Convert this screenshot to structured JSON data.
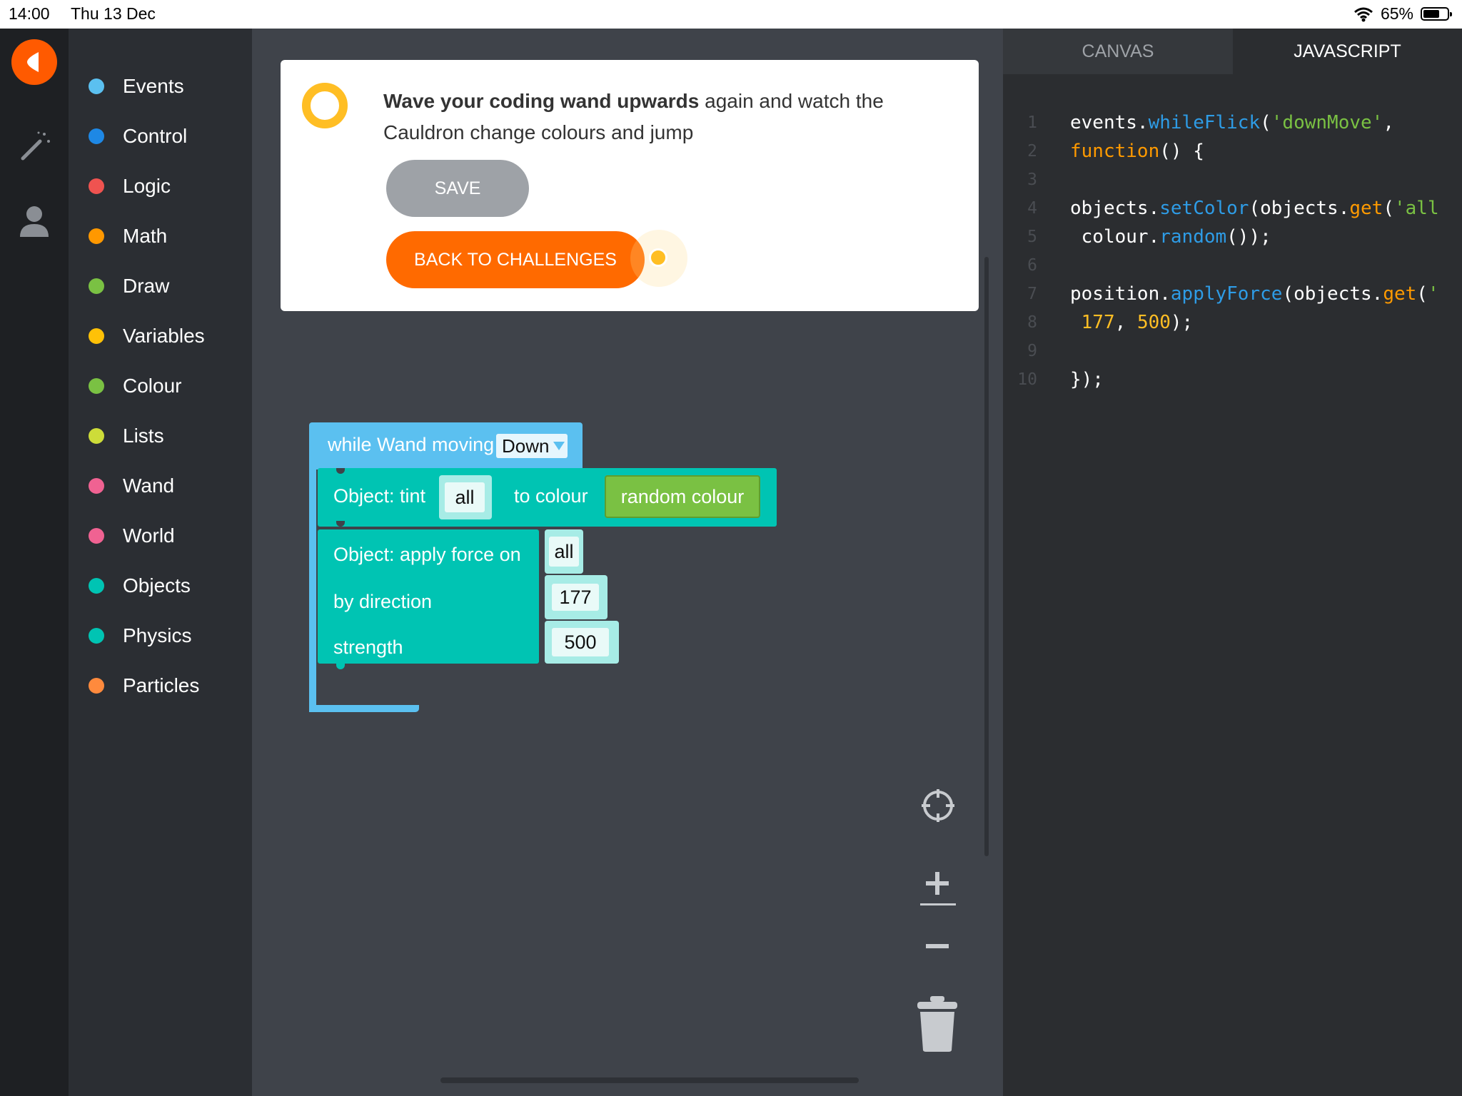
{
  "status_bar": {
    "time": "14:00",
    "date": "Thu 13 Dec",
    "battery": "65%"
  },
  "categories": [
    {
      "label": "Events",
      "color": "#5bc0f0"
    },
    {
      "label": "Control",
      "color": "#1e88e5"
    },
    {
      "label": "Logic",
      "color": "#ef5350"
    },
    {
      "label": "Math",
      "color": "#ff9800"
    },
    {
      "label": "Draw",
      "color": "#7ac143"
    },
    {
      "label": "Variables",
      "color": "#ffc107"
    },
    {
      "label": "Colour",
      "color": "#7ac143"
    },
    {
      "label": "Lists",
      "color": "#cddc39"
    },
    {
      "label": "Wand",
      "color": "#f06292"
    },
    {
      "label": "World",
      "color": "#f06292"
    },
    {
      "label": "Objects",
      "color": "#00c4b3"
    },
    {
      "label": "Physics",
      "color": "#00c4b3"
    },
    {
      "label": "Particles",
      "color": "#ff8a3d"
    }
  ],
  "challenge": {
    "bold": "Wave your coding wand upwards",
    "rest": " again and watch the Cauldron change colours and jump",
    "save_label": "SAVE",
    "back_label": "BACK TO CHALLENGES"
  },
  "blocks": {
    "hat_label": "while Wand moving",
    "hat_dropdown": "Down",
    "tint_label": "Object: tint",
    "tint_target": "all",
    "tint_to": "to colour",
    "tint_colour": "random colour",
    "force_label": "Object: apply force on",
    "force_target": "all",
    "direction_label": "by direction",
    "direction_value": "177",
    "strength_label": "strength",
    "strength_value": "500"
  },
  "panel": {
    "tab_canvas": "CANVAS",
    "tab_js": "JAVASCRIPT",
    "line_numbers": [
      "1",
      "2",
      "3",
      "4",
      "5",
      "6",
      "7",
      "8",
      "9",
      "10"
    ]
  },
  "colors": {
    "accent": "#ff6a00",
    "teal": "#00c4b3",
    "blue": "#5bc0f0",
    "green": "#7ac143"
  }
}
